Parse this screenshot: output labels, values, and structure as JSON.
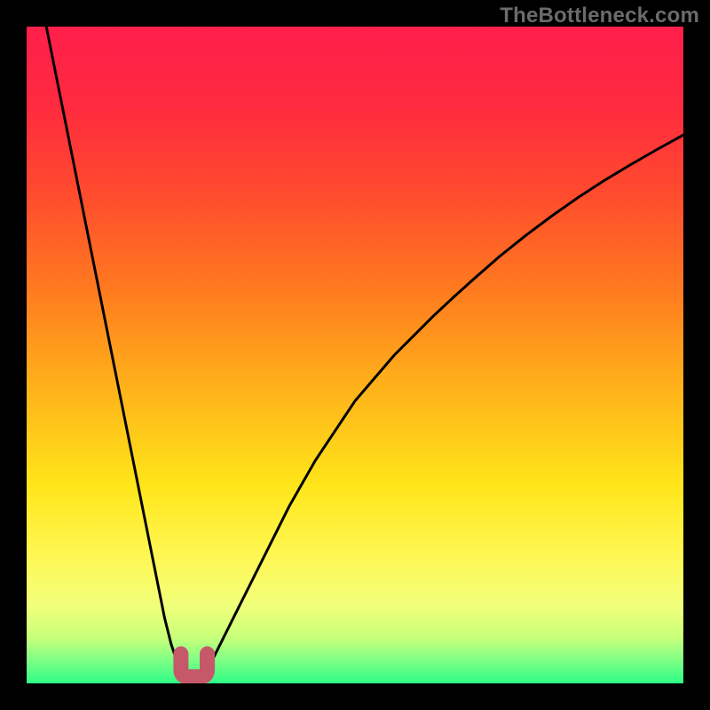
{
  "watermark": "TheBottleneck.com",
  "colors": {
    "frame": "#000000",
    "gradient_stops": [
      {
        "offset": 0.0,
        "color": "#ff1f4b"
      },
      {
        "offset": 0.12,
        "color": "#ff2a3f"
      },
      {
        "offset": 0.25,
        "color": "#ff4a2e"
      },
      {
        "offset": 0.4,
        "color": "#ff7a1f"
      },
      {
        "offset": 0.55,
        "color": "#ffb21a"
      },
      {
        "offset": 0.7,
        "color": "#ffe61a"
      },
      {
        "offset": 0.8,
        "color": "#fff650"
      },
      {
        "offset": 0.88,
        "color": "#f2ff7a"
      },
      {
        "offset": 0.93,
        "color": "#c8ff7a"
      },
      {
        "offset": 0.965,
        "color": "#7dff85"
      },
      {
        "offset": 1.0,
        "color": "#2dfd86"
      }
    ],
    "curve": "#000000",
    "marker": "#c5596a"
  },
  "chart_data": {
    "type": "line",
    "title": "",
    "xlabel": "",
    "ylabel": "",
    "xlim": [
      0,
      100
    ],
    "ylim": [
      0,
      100
    ],
    "x": [
      3,
      4,
      5,
      6,
      7,
      8,
      9,
      10,
      11,
      12,
      13,
      14,
      15,
      16,
      17,
      18,
      19,
      20,
      21,
      22,
      23,
      24,
      25,
      26,
      27,
      28,
      30,
      32,
      34,
      36,
      38,
      40,
      42,
      44,
      46,
      48,
      50,
      53,
      56,
      59,
      62,
      65,
      68,
      72,
      76,
      80,
      84,
      88,
      92,
      96,
      100
    ],
    "series": [
      {
        "name": "bottleneck-curve",
        "values": [
          100,
          95,
          90,
          85,
          80,
          75,
          70,
          65,
          60,
          55,
          50,
          45,
          40,
          35,
          30,
          25,
          20,
          15,
          10,
          6,
          3,
          1,
          0,
          0,
          1,
          3,
          7,
          11,
          15,
          19,
          23,
          27,
          30.5,
          34,
          37,
          40,
          43,
          46.5,
          50,
          53,
          56,
          58.8,
          61.5,
          65,
          68.2,
          71.2,
          74,
          76.6,
          79,
          81.3,
          83.5
        ]
      }
    ],
    "marker": {
      "name": "optimal-region",
      "x_range": [
        23.5,
        27.5
      ],
      "y": 1.5,
      "shape": "u"
    }
  }
}
